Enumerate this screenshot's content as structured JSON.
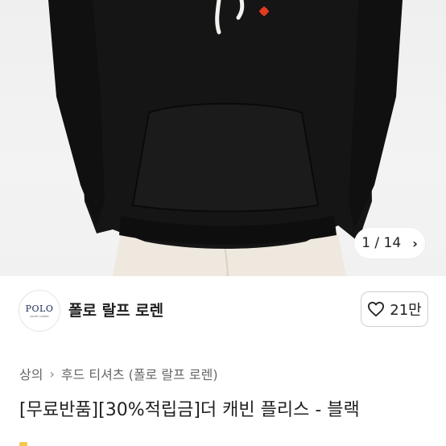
{
  "gallery": {
    "counter": "1 / 14",
    "next_icon": "chevron-right-icon"
  },
  "store": {
    "logo_text": "POLO",
    "logo_subtext": "RALPH LAUREN",
    "name": "폴로 랄프 로렌",
    "like_count": "21만",
    "like_icon": "heart-outline-icon"
  },
  "breadcrumb": {
    "items": [
      "상의",
      "후드 티셔츠 (폴로 랄프 로렌)"
    ]
  },
  "product": {
    "title": "[무료반품][30%적립금]더 캐빈 플리스 - 블랙"
  },
  "colors": {
    "hoodie": "#141414",
    "pants": "#efe9df",
    "background": "#f1f1f1",
    "logo_mark": "#e23b1e"
  }
}
